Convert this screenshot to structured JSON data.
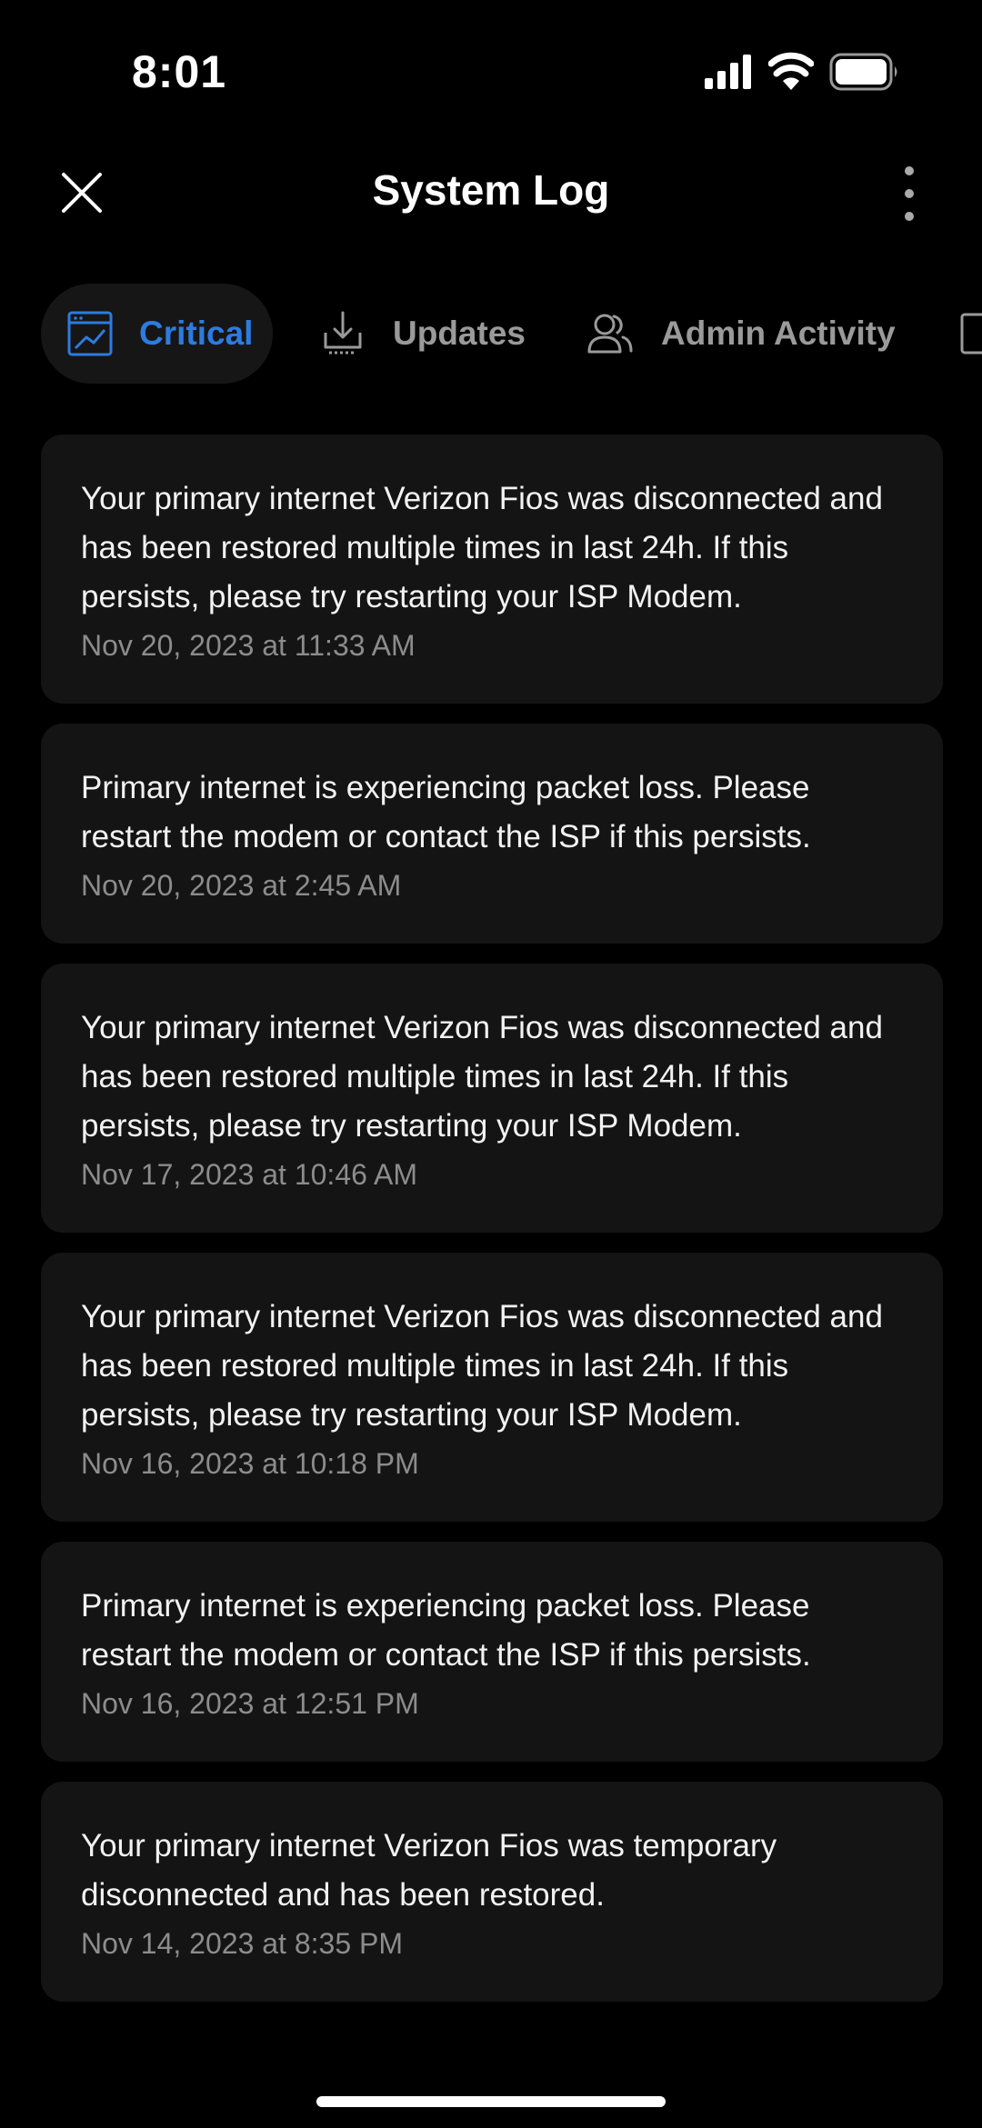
{
  "status_bar": {
    "time": "8:01",
    "signal_icon": "cellular-signal-icon",
    "wifi_icon": "wifi-icon",
    "battery_icon": "battery-icon"
  },
  "header": {
    "title": "System Log",
    "close_icon": "close-icon",
    "more_icon": "more-vertical-icon"
  },
  "tabs": [
    {
      "label": "Critical",
      "icon": "critical-window-icon",
      "active": true
    },
    {
      "label": "Updates",
      "icon": "download-tray-icon",
      "active": false
    },
    {
      "label": "Admin Activity",
      "icon": "users-icon",
      "active": false
    },
    {
      "label": "",
      "icon": "device-icon",
      "active": false
    }
  ],
  "logs": [
    {
      "message": "Your primary internet Verizon Fios was disconnected and has been restored multiple times in last 24h. If this persists, please try restarting your ISP Modem.",
      "timestamp": "Nov 20, 2023 at 11:33 AM"
    },
    {
      "message": "Primary internet is experiencing packet loss. Please restart the modem or contact the ISP if this persists.",
      "timestamp": "Nov 20, 2023 at 2:45 AM"
    },
    {
      "message": "Your primary internet Verizon Fios was disconnected and has been restored multiple times in last 24h. If this persists, please try restarting your ISP Modem.",
      "timestamp": "Nov 17, 2023 at 10:46 AM"
    },
    {
      "message": "Your primary internet Verizon Fios was disconnected and has been restored multiple times in last 24h. If this persists, please try restarting your ISP Modem.",
      "timestamp": "Nov 16, 2023 at 10:18 PM"
    },
    {
      "message": "Primary internet is experiencing packet loss. Please restart the modem or contact the ISP if this persists.",
      "timestamp": "Nov 16, 2023 at 12:51 PM"
    },
    {
      "message": "Your primary internet Verizon Fios was temporary disconnected and has been restored.",
      "timestamp": "Nov 14, 2023 at 8:35 PM"
    }
  ],
  "colors": {
    "background": "#000000",
    "card": "#141414",
    "accent": "#2d7be0",
    "muted_text": "#8c8c8c"
  }
}
